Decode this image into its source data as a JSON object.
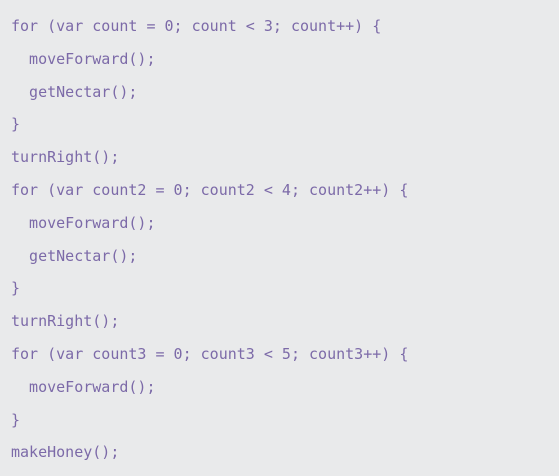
{
  "code": {
    "lines": [
      "for (var count = 0; count < 3; count++) {",
      "  moveForward();",
      "  getNectar();",
      "}",
      "turnRight();",
      "for (var count2 = 0; count2 < 4; count2++) {",
      "  moveForward();",
      "  getNectar();",
      "}",
      "turnRight();",
      "for (var count3 = 0; count3 < 5; count3++) {",
      "  moveForward();",
      "}",
      "makeHoney();"
    ]
  },
  "colors": {
    "background": "#e9eaeb",
    "code_text": "#7c6aa8"
  }
}
